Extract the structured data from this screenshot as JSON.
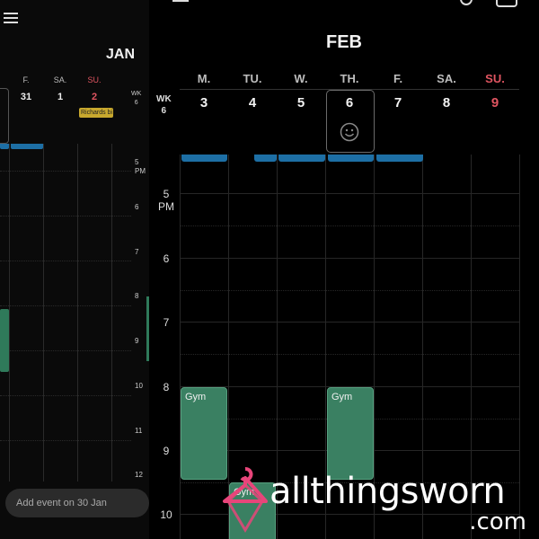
{
  "back": {
    "month": "JAN",
    "day_headers": [
      "F.",
      "SA.",
      "SU."
    ],
    "day_numbers": [
      "31",
      "1",
      "2"
    ],
    "week_label": [
      "WK",
      "6"
    ],
    "event_chip": "Richards bi",
    "times": [
      "5\nPM",
      "6",
      "7",
      "8",
      "9",
      "10",
      "11",
      "12"
    ],
    "add_event_placeholder": "Add event on 30 Jan"
  },
  "front": {
    "month": "FEB",
    "week_label": [
      "WK",
      "6"
    ],
    "days": [
      {
        "head": "M.",
        "num": "3"
      },
      {
        "head": "TU.",
        "num": "4"
      },
      {
        "head": "W.",
        "num": "5"
      },
      {
        "head": "TH.",
        "num": "6"
      },
      {
        "head": "F.",
        "num": "7"
      },
      {
        "head": "SA.",
        "num": "8"
      },
      {
        "head": "SU.",
        "num": "9"
      }
    ],
    "times": [
      "5\nPM",
      "6",
      "7",
      "8",
      "9",
      "10"
    ],
    "events": [
      {
        "day": "M.",
        "title": "Gym"
      },
      {
        "day": "TH.",
        "title": "Gym"
      },
      {
        "day": "TU.",
        "title": "Gym"
      }
    ]
  },
  "watermark": {
    "brand": "allthingsworn",
    "tld": ".com"
  },
  "colors": {
    "background": "#000000",
    "sunday": "#e05561",
    "event_green": "#3a8062",
    "event_blue": "#1d6fa5",
    "chip_yellow": "#c8a82e"
  }
}
